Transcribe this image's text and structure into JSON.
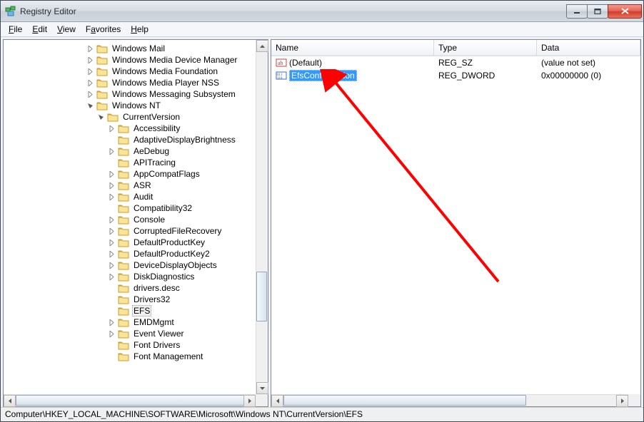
{
  "window": {
    "title": "Registry Editor"
  },
  "menu": {
    "file": "File",
    "edit": "Edit",
    "view": "View",
    "favorites": "Favorites",
    "help": "Help"
  },
  "tree": {
    "top_items": [
      {
        "label": "Windows Mail",
        "indent": 115,
        "exp": "closed"
      },
      {
        "label": "Windows Media Device Manager",
        "indent": 115,
        "exp": "closed"
      },
      {
        "label": "Windows Media Foundation",
        "indent": 115,
        "exp": "closed"
      },
      {
        "label": "Windows Media Player NSS",
        "indent": 115,
        "exp": "closed"
      },
      {
        "label": "Windows Messaging Subsystem",
        "indent": 115,
        "exp": "closed"
      },
      {
        "label": "Windows NT",
        "indent": 115,
        "exp": "open"
      }
    ],
    "current_version": {
      "label": "CurrentVersion",
      "indent": 130,
      "exp": "open"
    },
    "cv_children": [
      {
        "label": "Accessibility",
        "indent": 145,
        "exp": "closed"
      },
      {
        "label": "AdaptiveDisplayBrightness",
        "indent": 145,
        "exp": "none"
      },
      {
        "label": "AeDebug",
        "indent": 145,
        "exp": "closed"
      },
      {
        "label": "APITracing",
        "indent": 145,
        "exp": "none"
      },
      {
        "label": "AppCompatFlags",
        "indent": 145,
        "exp": "closed"
      },
      {
        "label": "ASR",
        "indent": 145,
        "exp": "closed"
      },
      {
        "label": "Audit",
        "indent": 145,
        "exp": "closed"
      },
      {
        "label": "Compatibility32",
        "indent": 145,
        "exp": "none"
      },
      {
        "label": "Console",
        "indent": 145,
        "exp": "closed"
      },
      {
        "label": "CorruptedFileRecovery",
        "indent": 145,
        "exp": "closed"
      },
      {
        "label": "DefaultProductKey",
        "indent": 145,
        "exp": "closed"
      },
      {
        "label": "DefaultProductKey2",
        "indent": 145,
        "exp": "closed"
      },
      {
        "label": "DeviceDisplayObjects",
        "indent": 145,
        "exp": "closed"
      },
      {
        "label": "DiskDiagnostics",
        "indent": 145,
        "exp": "closed"
      },
      {
        "label": "drivers.desc",
        "indent": 145,
        "exp": "none"
      },
      {
        "label": "Drivers32",
        "indent": 145,
        "exp": "none"
      },
      {
        "label": "EFS",
        "indent": 145,
        "exp": "none",
        "selected": true
      },
      {
        "label": "EMDMgmt",
        "indent": 145,
        "exp": "closed"
      },
      {
        "label": "Event Viewer",
        "indent": 145,
        "exp": "closed"
      },
      {
        "label": "Font Drivers",
        "indent": 145,
        "exp": "none"
      },
      {
        "label": "Font Management",
        "indent": 145,
        "exp": "none"
      }
    ]
  },
  "list": {
    "columns": {
      "name": "Name",
      "type": "Type",
      "data": "Data"
    },
    "col_widths": {
      "name": 228,
      "type": 144,
      "data": 110
    },
    "rows": [
      {
        "icon": "str",
        "name": "(Default)",
        "type": "REG_SZ",
        "data": "(value not set)",
        "selected": false
      },
      {
        "icon": "dword",
        "name": "EfsConfiguration",
        "type": "REG_DWORD",
        "data": "0x00000000 (0)",
        "selected": true
      }
    ]
  },
  "status": "Computer\\HKEY_LOCAL_MACHINE\\SOFTWARE\\Microsoft\\Windows NT\\CurrentVersion\\EFS"
}
